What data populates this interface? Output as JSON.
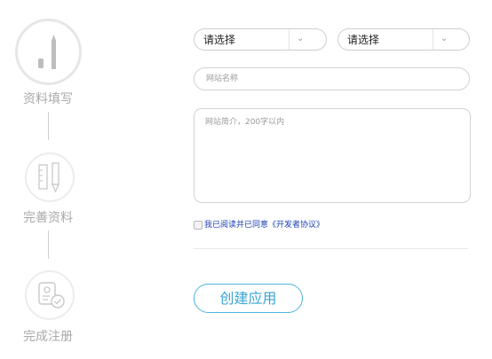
{
  "steps": [
    {
      "label": "资料填写",
      "icon": "pen-icon",
      "active": true
    },
    {
      "label": "完善资料",
      "icon": "ruler-pencil-icon",
      "active": false
    },
    {
      "label": "完成注册",
      "icon": "checked-document-icon",
      "active": false
    }
  ],
  "form": {
    "select_1": {
      "value": "请选择"
    },
    "select_2": {
      "value": "请选择"
    },
    "site_name": {
      "placeholder": "网站名称",
      "value": ""
    },
    "site_intro": {
      "placeholder": "网站简介，200字以内",
      "value": ""
    },
    "agreement": {
      "text": "我已阅读并已同意《开发者协议》",
      "checked": false
    }
  },
  "actions": {
    "create_label": "创建应用"
  },
  "colors": {
    "accent": "#39a4d4",
    "link": "#1a3fb4",
    "muted": "#a9a9a9"
  }
}
